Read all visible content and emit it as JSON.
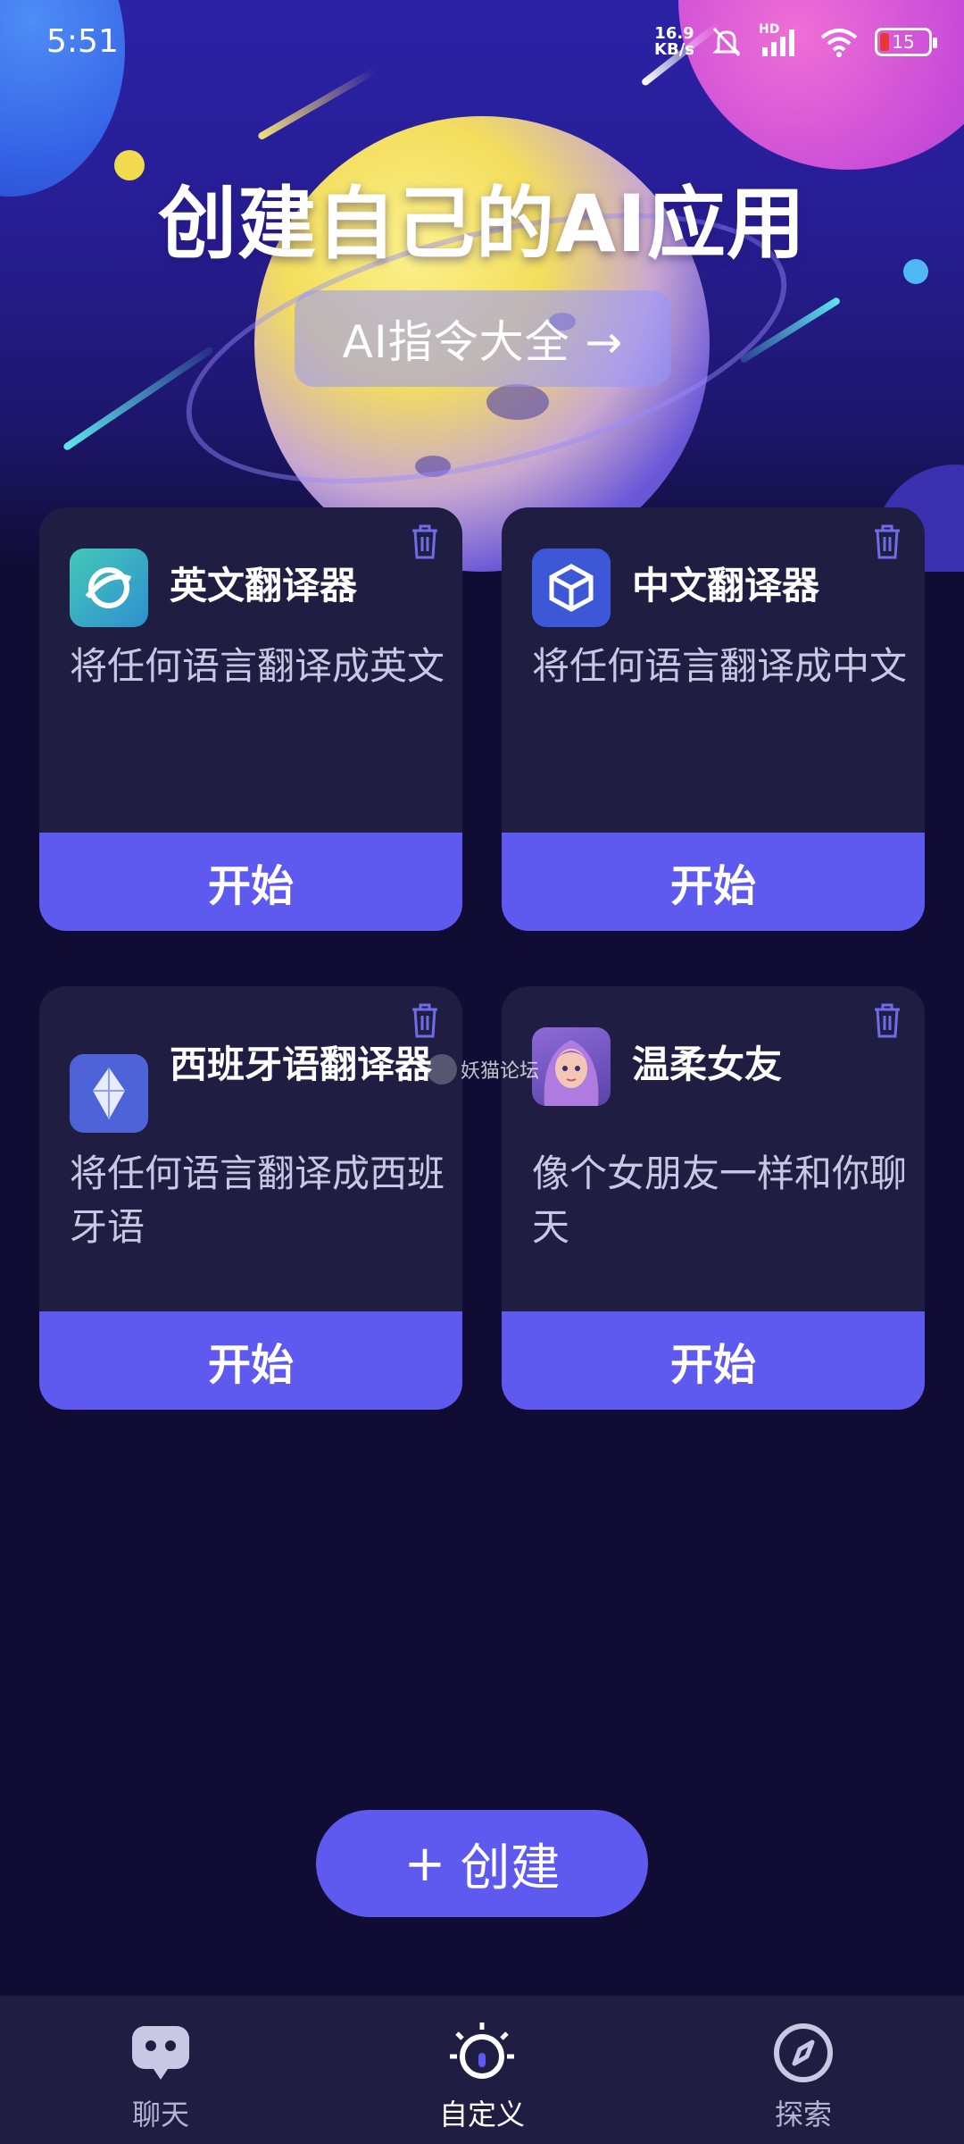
{
  "status_bar": {
    "time": "5:51",
    "net_speed_value": "16.9",
    "net_speed_unit": "KB/s",
    "network_label": "HD",
    "battery_level": "15"
  },
  "hero": {
    "title": "创建自己的AI应用",
    "button_label": "AI指令大全 →"
  },
  "cards": [
    {
      "title": "英文翻译器",
      "description": "将任何语言翻译成英文",
      "start_label": "开始",
      "icon": "globe-translate-icon",
      "icon_color": "#2fbf9e"
    },
    {
      "title": "中文翻译器",
      "description": "将任何语言翻译成中文",
      "start_label": "开始",
      "icon": "cube-icon",
      "icon_color": "#3d58d6"
    },
    {
      "title": "西班牙语翻译器",
      "description": "将任何语言翻译成西班牙语",
      "start_label": "开始",
      "icon": "crystal-icon",
      "icon_color": "#4f63d8"
    },
    {
      "title": "温柔女友",
      "description": "像个女朋友一样和你聊天",
      "start_label": "开始",
      "icon": "girl-avatar",
      "icon_color": "#7b5fd0"
    }
  ],
  "watermark": "妖猫论坛",
  "create_button": {
    "plus": "+",
    "label": "创建"
  },
  "bottom_nav": [
    {
      "label": "聊天",
      "icon": "chat-bot-icon",
      "active": false
    },
    {
      "label": "自定义",
      "icon": "bulb-icon",
      "active": true
    },
    {
      "label": "探索",
      "icon": "compass-icon",
      "active": false
    }
  ],
  "colors": {
    "accent": "#5e5af0",
    "card_bg": "#1f1e42",
    "page_bg": "#100c33"
  }
}
